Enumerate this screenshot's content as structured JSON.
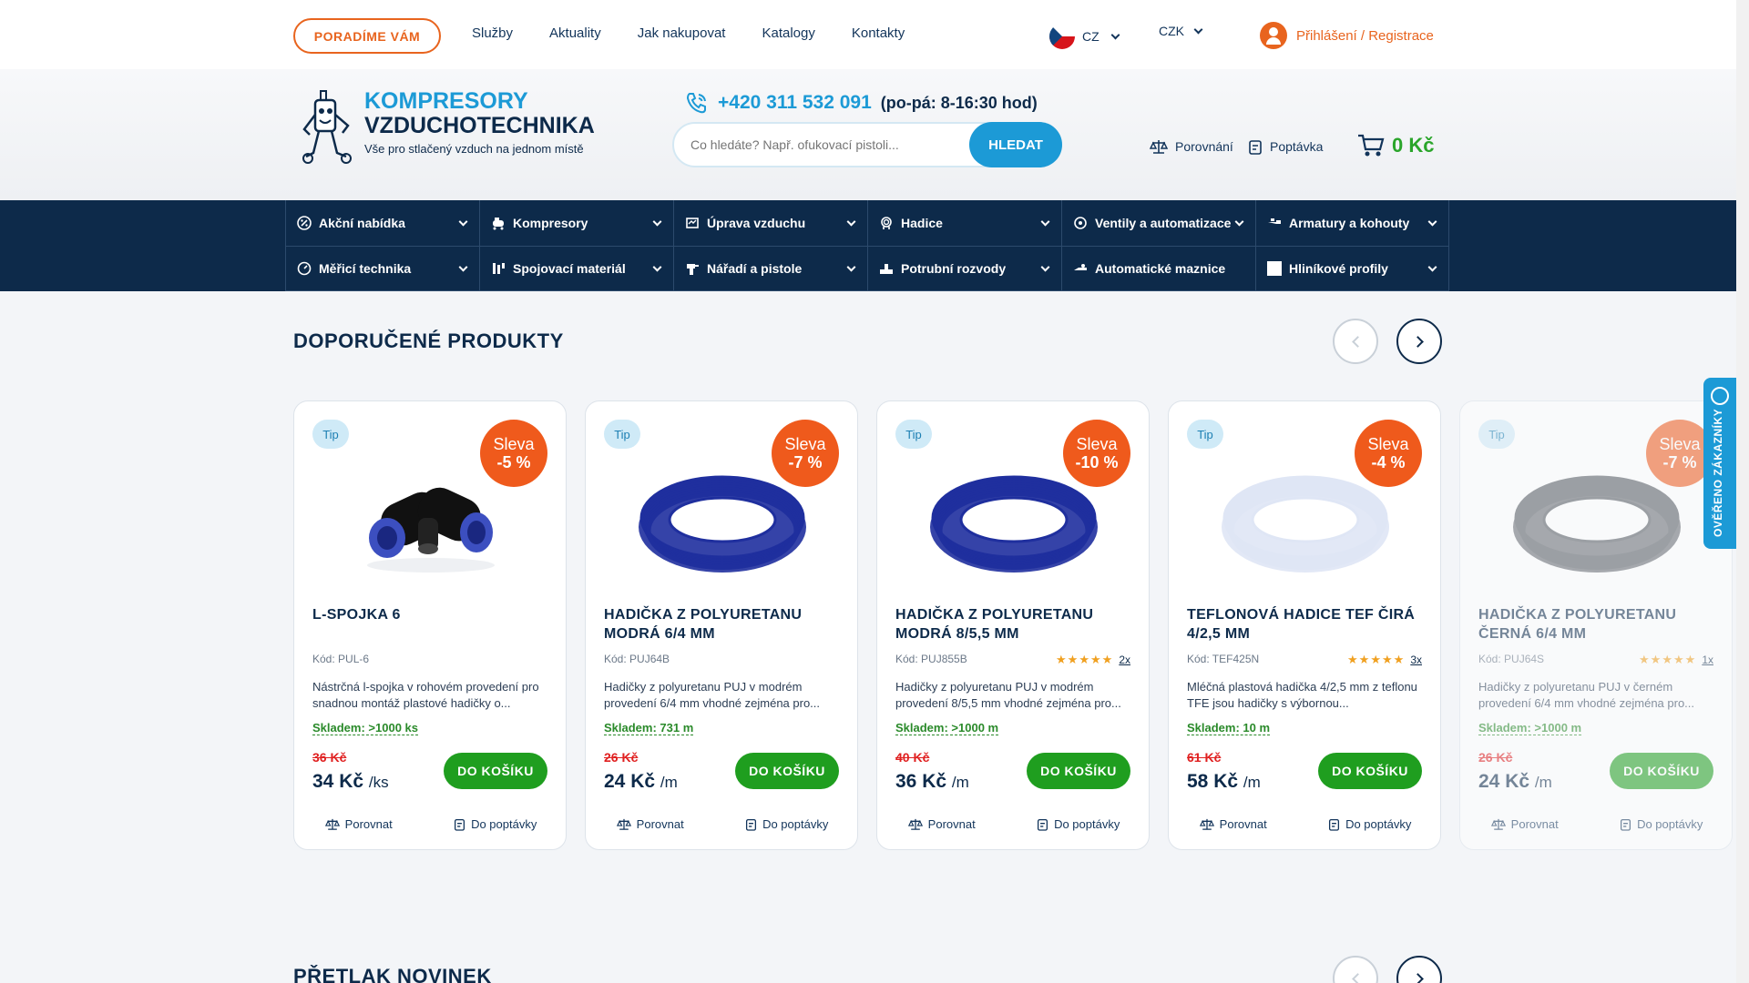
{
  "topbar": {
    "advise_label": "PORADÍME VÁM",
    "nav": [
      "Služby",
      "Aktuality",
      "Jak nakupovat",
      "Katalogy",
      "Kontakty"
    ],
    "language": "CZ",
    "currency": "CZK",
    "login_label": "Přihlášení / Registrace"
  },
  "header": {
    "logo_line1": "KOMPRESORY",
    "logo_line2": "VZDUCHOTECHNIKA",
    "logo_tagline": "Vše pro stlačený vzduch na jednom místě",
    "phone": "+420 311 532 091",
    "hours": "(po-pá: 8-16:30 hod)",
    "search_placeholder": "Co hledáte? Např. ofukovací pistoli...",
    "search_button": "HLEDAT",
    "compare_label": "Porovnání",
    "inquiry_label": "Poptávka",
    "cart_value": "0 Kč"
  },
  "categories": [
    {
      "label": "Akční nabídka",
      "icon": "percent-icon",
      "chevron": true
    },
    {
      "label": "Kompresory",
      "icon": "compressor-icon",
      "chevron": true
    },
    {
      "label": "Úprava vzduchu",
      "icon": "air-treatment-icon",
      "chevron": true
    },
    {
      "label": "Hadice",
      "icon": "hose-icon",
      "chevron": true
    },
    {
      "label": "Ventily a automatizace",
      "icon": "valve-icon",
      "chevron": true
    },
    {
      "label": "Armatury a kohouty",
      "icon": "faucet-icon",
      "chevron": true
    },
    {
      "label": "Měřicí technika",
      "icon": "gauge-icon",
      "chevron": true
    },
    {
      "label": "Spojovací materiál",
      "icon": "fittings-icon",
      "chevron": true
    },
    {
      "label": "Nářadí a pistole",
      "icon": "tool-icon",
      "chevron": true
    },
    {
      "label": "Potrubní rozvody",
      "icon": "pipe-icon",
      "chevron": true
    },
    {
      "label": "Automatické maznice",
      "icon": "lubricator-icon",
      "chevron": false
    },
    {
      "label": "Hliníkové profily",
      "icon": "profile-icon",
      "chevron": true
    }
  ],
  "section": {
    "title": "DOPORUČENÉ PRODUKTY",
    "next_title": "PŘETLAK NOVINEK"
  },
  "product_common": {
    "tip": "Tip",
    "sale_word": "Sleva",
    "code_prefix": "Kód:",
    "stock_prefix": "Skladem:",
    "buy": "DO KOŠÍKU",
    "compare": "Porovnat",
    "inquiry": "Do poptávky"
  },
  "products": [
    {
      "name": "L-SPOJKA 6",
      "sale": "-5 %",
      "code": "Kód: PUL-6",
      "rating_count": "",
      "desc": "Nástrčná l-spojka v rohovém provedení pro snadnou montáž plastové hadičky o...",
      "stock": "Skladem: >1000 ks",
      "old_price": "36 Kč",
      "price": "34 Kč",
      "unit": "/ks",
      "image": "l-fitting",
      "color": "#111111"
    },
    {
      "name": "HADIČKA Z POLYURETANU MODRÁ 6/4 MM",
      "sale": "-7 %",
      "code": "Kód: PUJ64B",
      "rating_count": "",
      "desc": "Hadičky z polyuretanu PUJ v modrém provedení 6/4 mm vhodné zejména pro...",
      "stock": "Skladem: 731 m",
      "old_price": "26 Kč",
      "price": "24 Kč",
      "unit": "/m",
      "image": "hose-coil",
      "color": "#1f2f9e"
    },
    {
      "name": "HADIČKA Z POLYURETANU MODRÁ 8/5,5 MM",
      "sale": "-10 %",
      "code": "Kód: PUJ855B",
      "rating_count": "2x",
      "desc": "Hadičky z polyuretanu PUJ v modrém provedení 8/5,5 mm vhodné zejména pro...",
      "stock": "Skladem: >1000 m",
      "old_price": "40 Kč",
      "price": "36 Kč",
      "unit": "/m",
      "image": "hose-coil",
      "color": "#1f2f9e"
    },
    {
      "name": "TEFLONOVÁ HADICE TEF ČIRÁ 4/2,5 MM",
      "sale": "-4 %",
      "code": "Kód: TEF425N",
      "rating_count": "3x",
      "desc": "Mléčná plastová hadička 4/2,5 mm z teflonu TFE jsou hadičky s výbornou...",
      "stock": "Skladem: 10 m",
      "old_price": "61 Kč",
      "price": "58 Kč",
      "unit": "/m",
      "image": "hose-coil",
      "color": "#dfe6f5"
    },
    {
      "name": "HADIČKA Z POLYURETANU ČERNÁ 6/4 MM",
      "sale": "-7 %",
      "code": "Kód: PUJ64S",
      "rating_count": "1x",
      "desc": "Hadičky z polyuretanu PUJ v černém provedení 6/4 mm vhodné zejména pro...",
      "stock": "Skladem: >1000 m",
      "old_price": "26 Kč",
      "price": "24 Kč",
      "unit": "/m",
      "image": "hose-coil",
      "color": "#555a60"
    }
  ],
  "verified_badge": "OVĚŘENO ZÁKAZNÍKY"
}
